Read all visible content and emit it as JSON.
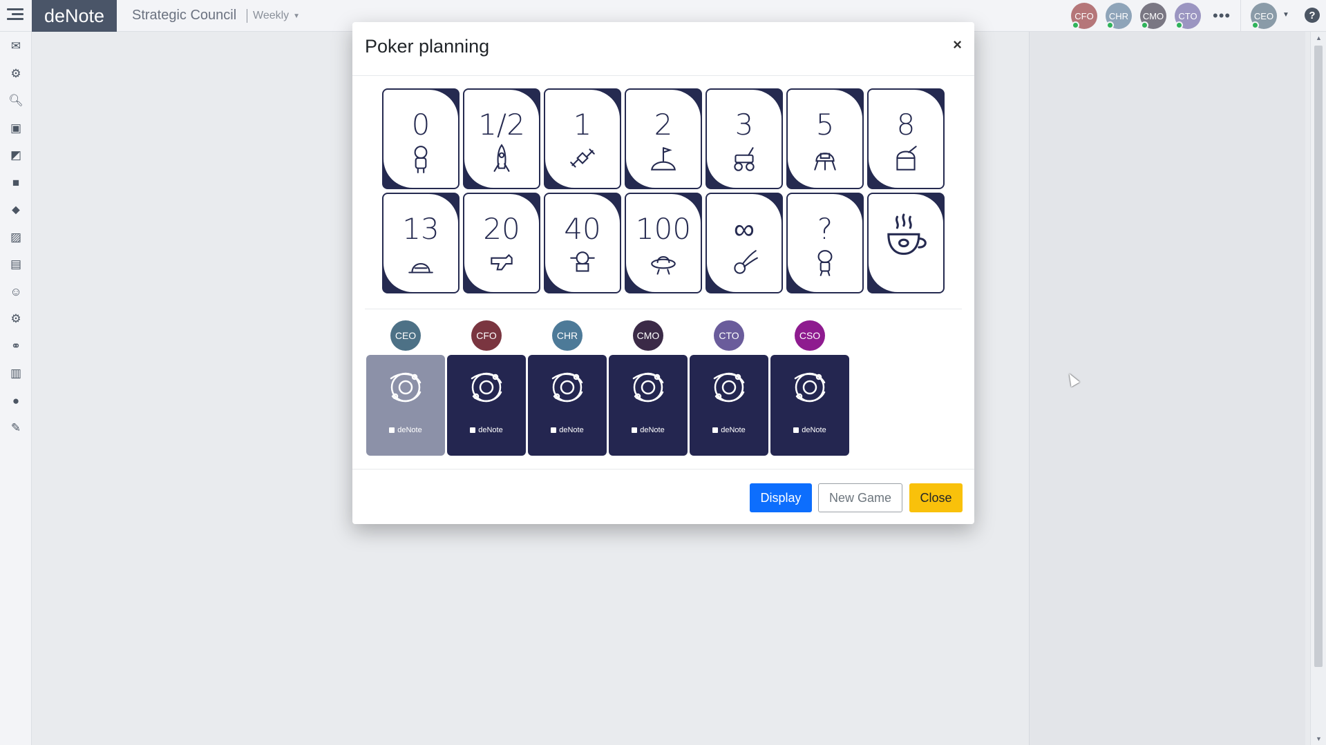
{
  "app": {
    "brand_prefix": "de",
    "brand_suffix": "Note",
    "meeting_title": "Strategic Council",
    "meeting_cadence": "Weekly"
  },
  "topbar": {
    "participants": [
      {
        "initials": "CFO",
        "color": "#b57679"
      },
      {
        "initials": "CHR",
        "color": "#8ea4b9"
      },
      {
        "initials": "CMO",
        "color": "#7a7783"
      },
      {
        "initials": "CTO",
        "color": "#9b95c1"
      }
    ],
    "more_label": "•••",
    "current_user": {
      "initials": "CEO",
      "color": "#8a9ba8"
    },
    "help_label": "?"
  },
  "sidebar": {
    "icons": [
      "menu-icon",
      "envelope-icon",
      "gear-icon",
      "search-icon",
      "inbox-icon",
      "sticky-note-icon",
      "square-icon",
      "tag-icon",
      "image-icon",
      "briefcase-icon",
      "smile-icon",
      "gears-icon",
      "link-icon",
      "book-icon",
      "globe-icon",
      "magic-wand-icon"
    ]
  },
  "modal": {
    "title": "Poker planning",
    "close_symbol": "×",
    "cards": [
      {
        "value": "0",
        "art": "astronaut"
      },
      {
        "value": "1/2",
        "art": "rocket"
      },
      {
        "value": "1",
        "art": "satellite"
      },
      {
        "value": "2",
        "art": "moon-flag"
      },
      {
        "value": "3",
        "art": "rover"
      },
      {
        "value": "5",
        "art": "lander"
      },
      {
        "value": "8",
        "art": "observatory"
      },
      {
        "value": "13",
        "art": "moon-base"
      },
      {
        "value": "20",
        "art": "ray-gun"
      },
      {
        "value": "40",
        "art": "space-station"
      },
      {
        "value": "100",
        "art": "ufo"
      },
      {
        "value": "∞",
        "art": "comet"
      },
      {
        "value": "?",
        "art": "alien"
      },
      {
        "value": "★",
        "art": "coffee-cup",
        "hide_value": true
      }
    ],
    "players": [
      {
        "initials": "CEO",
        "color": "#4d7186",
        "mine": true
      },
      {
        "initials": "CFO",
        "color": "#7a3540"
      },
      {
        "initials": "CHR",
        "color": "#4d7a98"
      },
      {
        "initials": "CMO",
        "color": "#3b2a47"
      },
      {
        "initials": "CTO",
        "color": "#6a5c9b"
      },
      {
        "initials": "CSO",
        "color": "#8e1b8f"
      }
    ],
    "card_back_brand": "deNote",
    "buttons": {
      "display": "Display",
      "new_game": "New Game",
      "close": "Close"
    }
  }
}
